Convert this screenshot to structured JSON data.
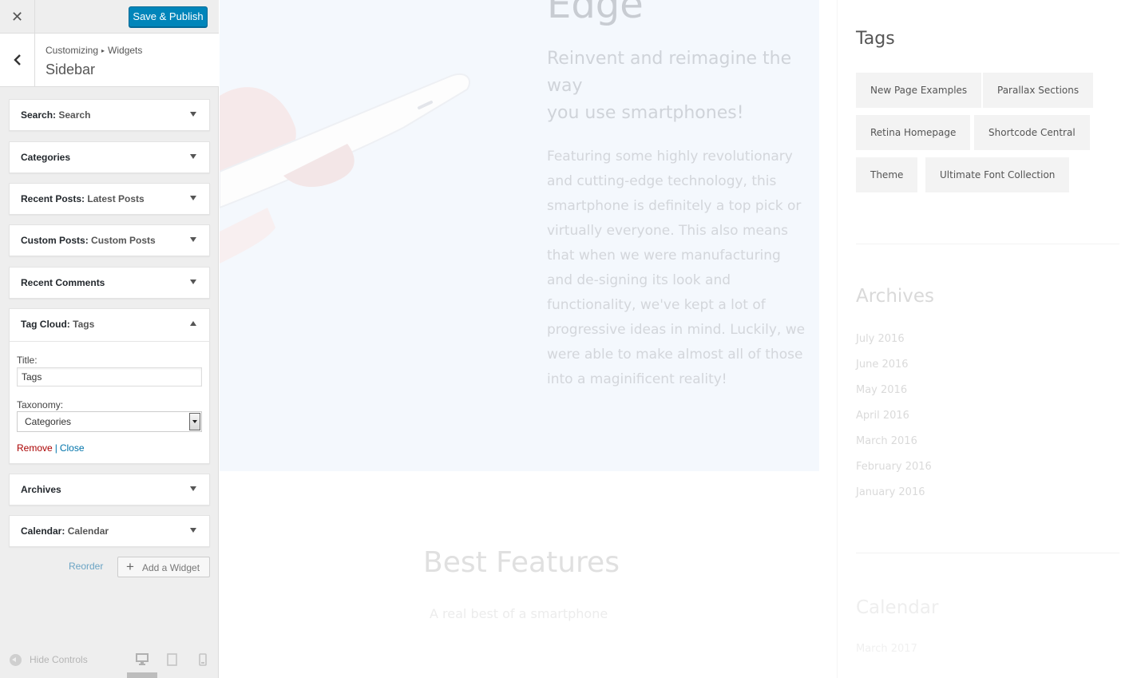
{
  "customizer": {
    "close_glyph": "✕",
    "save_label": "Save & Publish",
    "breadcrumb": {
      "part1": "Customizing",
      "separator": "▸",
      "part2": "Widgets"
    },
    "section_title": "Sidebar",
    "widgets": [
      {
        "type": "Search",
        "title": "Search",
        "expanded": false
      },
      {
        "type": "Categories",
        "title": "",
        "expanded": false
      },
      {
        "type": "Recent Posts",
        "title": "Latest Posts",
        "expanded": false
      },
      {
        "type": "Custom Posts",
        "title": "Custom Posts",
        "expanded": false
      },
      {
        "type": "Recent Comments",
        "title": "",
        "expanded": false
      },
      {
        "type": "Tag Cloud",
        "title": "Tags",
        "expanded": true
      },
      {
        "type": "Archives",
        "title": "",
        "expanded": false
      },
      {
        "type": "Calendar",
        "title": "Calendar",
        "expanded": false
      }
    ],
    "colon": ":",
    "tag_cloud_form": {
      "title_label": "Title:",
      "title_value": "Tags",
      "taxonomy_label": "Taxonomy:",
      "taxonomy_value": "Categories",
      "remove_label": "Remove",
      "separator": "|",
      "close_label": "Close"
    },
    "reorder_label": "Reorder",
    "add_widget_label": "Add a Widget",
    "add_widget_glyph": "+",
    "hide_controls_label": "Hide Controls",
    "devices": [
      "desktop-icon",
      "tablet-icon",
      "mobile-icon"
    ],
    "accent_color": "#0085ba"
  },
  "preview": {
    "hero": {
      "title": "Edge",
      "subtitle_line1": "Reinvent and reimagine the way",
      "subtitle_line2": "you use smartphones!",
      "body": "Featuring some highly revolutionary and cutting-edge technology, this smartphone is definitely a top pick or virtually everyone. This also means that when we were manufacturing and de-signing its look and functionality, we've kept a lot of progressive ideas in mind. Luckily, we were able to make almost all of those into a maginificent reality!"
    },
    "features": {
      "title": "Best Features",
      "subtitle": "A real best of a smartphone"
    },
    "sidebar": {
      "tags_heading": "Tags",
      "tags": [
        "New Page Examples",
        "Parallax Sections",
        "Retina Homepage",
        "Shortcode Central",
        "Theme",
        "Ultimate Font Collection"
      ],
      "archives_heading": "Archives",
      "archives": [
        "July 2016",
        "June 2016",
        "May 2016",
        "April 2016",
        "March 2016",
        "February 2016",
        "January 2016"
      ],
      "calendar_heading": "Calendar",
      "calendar_month": "March 2017"
    }
  }
}
